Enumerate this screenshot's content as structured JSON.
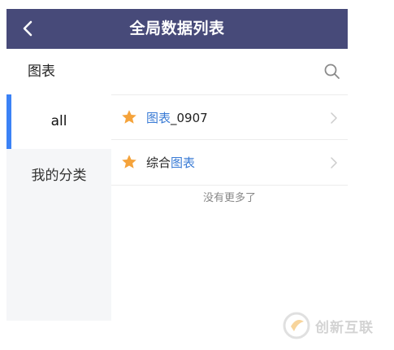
{
  "header": {
    "title": "全局数据列表",
    "back_icon": "chevron-left-icon"
  },
  "search_row": {
    "label": "图表",
    "search_icon": "search-icon"
  },
  "sidebar": {
    "items": [
      {
        "label": "all",
        "active": true
      },
      {
        "label": "我的分类",
        "active": false
      }
    ]
  },
  "list": {
    "items": [
      {
        "prefix": "",
        "highlight": "图表",
        "suffix": "_0907",
        "icon": "star-icon"
      },
      {
        "prefix": "综合",
        "highlight": "图表",
        "suffix": "",
        "icon": "star-icon"
      }
    ],
    "footer": "没有更多了"
  },
  "watermark": {
    "text": "创新互联"
  },
  "colors": {
    "header_bg": "#474a79",
    "accent": "#3b82f6",
    "star": "#f5a33b",
    "highlight": "#3a7bd5"
  }
}
